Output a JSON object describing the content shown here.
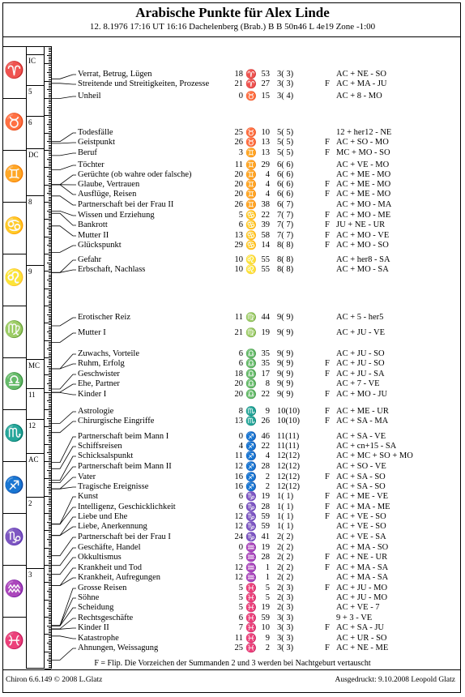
{
  "header": {
    "title": "Arabische Punkte für Alex Linde",
    "subtitle": "12. 8.1976 17:16 UT 16:16 Dachelenberg (Brab.) B B 50n46 L 4e19 Zone -1:00"
  },
  "signs": [
    {
      "glyph": "♈",
      "name": "aries",
      "color": "#d00000"
    },
    {
      "glyph": "♉",
      "name": "taurus",
      "color": "#00a000"
    },
    {
      "glyph": "♊",
      "name": "gemini",
      "color": "#e08000"
    },
    {
      "glyph": "♋",
      "name": "cancer",
      "color": "#0000d0"
    },
    {
      "glyph": "♌",
      "name": "leo",
      "color": "#d00000"
    },
    {
      "glyph": "♍",
      "name": "virgo",
      "color": "#00a000"
    },
    {
      "glyph": "♎",
      "name": "libra",
      "color": "#e08000"
    },
    {
      "glyph": "♏",
      "name": "scorpio",
      "color": "#0000d0"
    },
    {
      "glyph": "♐",
      "name": "sagittarius",
      "color": "#d00000"
    },
    {
      "glyph": "♑",
      "name": "capricorn",
      "color": "#00a000"
    },
    {
      "glyph": "♒",
      "name": "aquarius",
      "color": "#e08000"
    },
    {
      "glyph": "♓",
      "name": "pisces",
      "color": "#0000d0"
    }
  ],
  "houses": [
    "IC",
    "5",
    "6",
    "DC",
    "8",
    "9",
    "MC",
    "11",
    "12",
    "AC",
    "2",
    "3"
  ],
  "rows": [
    {
      "name": "Verrat, Betrug, Lügen",
      "deg": "18",
      "sign": 0,
      "min": "53",
      "house": "3(  3)",
      "flip": "",
      "formula": "AC + NE - SO"
    },
    {
      "name": "Streitende und Streitigkeiten, Prozesse",
      "deg": "21",
      "sign": 0,
      "min": "27",
      "house": "3(  3)",
      "flip": "F",
      "formula": "AC + MA - JU"
    },
    {
      "name": "Unheil",
      "deg": "0",
      "sign": 1,
      "min": "15",
      "house": "3(  4)",
      "flip": "",
      "formula": "AC + 8 - MO"
    },
    {
      "name": "Todesfälle",
      "deg": "25",
      "sign": 1,
      "min": "10",
      "house": "5(  5)",
      "flip": "",
      "formula": "12 + her12 - NE"
    },
    {
      "name": "Geistpunkt",
      "deg": "26",
      "sign": 1,
      "min": "13",
      "house": "5(  5)",
      "flip": "F",
      "formula": "AC + SO - MO"
    },
    {
      "name": "Beruf",
      "deg": "3",
      "sign": 2,
      "min": "13",
      "house": "5(  5)",
      "flip": "F",
      "formula": "MC + MO - SO"
    },
    {
      "name": "Töchter",
      "deg": "11",
      "sign": 2,
      "min": "29",
      "house": "6(  6)",
      "flip": "",
      "formula": "AC + VE - MO"
    },
    {
      "name": "Gerüchte (ob wahre oder falsche)",
      "deg": "20",
      "sign": 2,
      "min": "4",
      "house": "6(  6)",
      "flip": "",
      "formula": "AC + ME - MO"
    },
    {
      "name": "Glaube, Vertrauen",
      "deg": "20",
      "sign": 2,
      "min": "4",
      "house": "6(  6)",
      "flip": "F",
      "formula": "AC + ME - MO"
    },
    {
      "name": "Ausflüge, Reisen",
      "deg": "20",
      "sign": 2,
      "min": "4",
      "house": "6(  6)",
      "flip": "F",
      "formula": "AC + ME - MO"
    },
    {
      "name": "Partnerschaft bei der Frau II",
      "deg": "26",
      "sign": 2,
      "min": "38",
      "house": "6(  7)",
      "flip": "",
      "formula": "AC + MO - MA"
    },
    {
      "name": "Wissen und Erziehung",
      "deg": "5",
      "sign": 3,
      "min": "22",
      "house": "7(  7)",
      "flip": "F",
      "formula": "AC + MO - ME"
    },
    {
      "name": "Bankrott",
      "deg": "6",
      "sign": 3,
      "min": "39",
      "house": "7(  7)",
      "flip": "F",
      "formula": "JU + NE - UR"
    },
    {
      "name": "Mutter II",
      "deg": "13",
      "sign": 3,
      "min": "58",
      "house": "7(  7)",
      "flip": "F",
      "formula": "AC + MO - VE"
    },
    {
      "name": "Glückspunkt",
      "deg": "29",
      "sign": 3,
      "min": "14",
      "house": "8(  8)",
      "flip": "F",
      "formula": "AC + MO - SO"
    },
    {
      "name": "Gefahr",
      "deg": "10",
      "sign": 4,
      "min": "55",
      "house": "8(  8)",
      "flip": "",
      "formula": "AC + her8 - SA"
    },
    {
      "name": "Erbschaft, Nachlass",
      "deg": "10",
      "sign": 4,
      "min": "55",
      "house": "8(  8)",
      "flip": "",
      "formula": "AC + MO - SA"
    },
    {
      "name": "Erotischer Reiz",
      "deg": "11",
      "sign": 5,
      "min": "44",
      "house": "9(  9)",
      "flip": "",
      "formula": "AC + 5 - her5"
    },
    {
      "name": "Mutter I",
      "deg": "21",
      "sign": 5,
      "min": "19",
      "house": "9(  9)",
      "flip": "",
      "formula": "AC + JU - VE"
    },
    {
      "name": "Zuwachs, Vorteile",
      "deg": "6",
      "sign": 6,
      "min": "35",
      "house": "9(  9)",
      "flip": "",
      "formula": "AC + JU - SO"
    },
    {
      "name": "Ruhm, Erfolg",
      "deg": "6",
      "sign": 6,
      "min": "35",
      "house": "9(  9)",
      "flip": "F",
      "formula": "AC + JU - SO"
    },
    {
      "name": "Geschwister",
      "deg": "18",
      "sign": 6,
      "min": "17",
      "house": "9(  9)",
      "flip": "F",
      "formula": "AC + JU - SA"
    },
    {
      "name": "Ehe, Partner",
      "deg": "20",
      "sign": 6,
      "min": "8",
      "house": "9(  9)",
      "flip": "",
      "formula": "AC + 7 - VE"
    },
    {
      "name": "Kinder I",
      "deg": "20",
      "sign": 6,
      "min": "22",
      "house": "9(  9)",
      "flip": "F",
      "formula": "AC + MO - JU"
    },
    {
      "name": "Astrologie",
      "deg": "8",
      "sign": 7,
      "min": "9",
      "house": "10(10)",
      "flip": "F",
      "formula": "AC + ME - UR"
    },
    {
      "name": "Chirurgische Eingriffe",
      "deg": "13",
      "sign": 7,
      "min": "26",
      "house": "10(10)",
      "flip": "F",
      "formula": "AC + SA - MA"
    },
    {
      "name": "Partnerschaft beim Mann I",
      "deg": "0",
      "sign": 8,
      "min": "46",
      "house": "11(11)",
      "flip": "",
      "formula": "AC + SA - VE"
    },
    {
      "name": "Schiffsreisen",
      "deg": "4",
      "sign": 8,
      "min": "22",
      "house": "11(11)",
      "flip": "",
      "formula": "AC + cn+15 - SA"
    },
    {
      "name": "Schicksalspunkt",
      "deg": "11",
      "sign": 8,
      "min": "4",
      "house": "12(12)",
      "flip": "",
      "formula": "AC + MC + SO + MO"
    },
    {
      "name": "Partnerschaft beim Mann II",
      "deg": "12",
      "sign": 8,
      "min": "28",
      "house": "12(12)",
      "flip": "",
      "formula": "AC + SO - VE"
    },
    {
      "name": "Vater",
      "deg": "16",
      "sign": 8,
      "min": "2",
      "house": "12(12)",
      "flip": "F",
      "formula": "AC + SA - SO"
    },
    {
      "name": "Tragische Ereignisse",
      "deg": "16",
      "sign": 8,
      "min": "2",
      "house": "12(12)",
      "flip": "",
      "formula": "AC + SA - SO"
    },
    {
      "name": "Kunst",
      "deg": "6",
      "sign": 9,
      "min": "19",
      "house": "1(  1)",
      "flip": "F",
      "formula": "AC + ME - VE"
    },
    {
      "name": "Intelligenz, Geschicklichkeit",
      "deg": "6",
      "sign": 9,
      "min": "28",
      "house": "1(  1)",
      "flip": "F",
      "formula": "AC + MA - ME"
    },
    {
      "name": "Liebe und Ehe",
      "deg": "12",
      "sign": 9,
      "min": "59",
      "house": "1(  1)",
      "flip": "F",
      "formula": "AC + VE - SO"
    },
    {
      "name": "Liebe, Anerkennung",
      "deg": "12",
      "sign": 9,
      "min": "59",
      "house": "1(  1)",
      "flip": "",
      "formula": "AC + VE - SO"
    },
    {
      "name": "Partnerschaft bei der Frau I",
      "deg": "24",
      "sign": 9,
      "min": "41",
      "house": "2(  2)",
      "flip": "",
      "formula": "AC + VE - SA"
    },
    {
      "name": "Geschäfte, Handel",
      "deg": "0",
      "sign": 10,
      "min": "19",
      "house": "2(  2)",
      "flip": "",
      "formula": "AC + MA - SO"
    },
    {
      "name": "Okkultismus",
      "deg": "5",
      "sign": 10,
      "min": "28",
      "house": "2(  2)",
      "flip": "F",
      "formula": "AC + NE - UR"
    },
    {
      "name": "Krankheit und Tod",
      "deg": "12",
      "sign": 10,
      "min": "1",
      "house": "2(  2)",
      "flip": "F",
      "formula": "AC + MA - SA"
    },
    {
      "name": "Krankheit, Aufregungen",
      "deg": "12",
      "sign": 10,
      "min": "1",
      "house": "2(  2)",
      "flip": "",
      "formula": "AC + MA - SA"
    },
    {
      "name": "Grosse Reisen",
      "deg": "5",
      "sign": 11,
      "min": "5",
      "house": "2(  3)",
      "flip": "F",
      "formula": "AC + JU - MO"
    },
    {
      "name": "Söhne",
      "deg": "5",
      "sign": 11,
      "min": "5",
      "house": "2(  3)",
      "flip": "",
      "formula": "AC + JU - MO"
    },
    {
      "name": "Scheidung",
      "deg": "5",
      "sign": 11,
      "min": "19",
      "house": "2(  3)",
      "flip": "",
      "formula": "AC + VE - 7"
    },
    {
      "name": "Rechtsgeschäfte",
      "deg": "6",
      "sign": 11,
      "min": "59",
      "house": "3(  3)",
      "flip": "",
      "formula": "9 + 3 - VE"
    },
    {
      "name": "Kinder II",
      "deg": "7",
      "sign": 11,
      "min": "10",
      "house": "3(  3)",
      "flip": "F",
      "formula": "AC + SA - JU"
    },
    {
      "name": "Katastrophe",
      "deg": "11",
      "sign": 11,
      "min": "9",
      "house": "3(  3)",
      "flip": "",
      "formula": "AC + UR - SO"
    },
    {
      "name": "Ahnungen, Weissagung",
      "deg": "25",
      "sign": 11,
      "min": "2",
      "house": "3(  3)",
      "flip": "F",
      "formula": "AC + NE - ME"
    }
  ],
  "footnote": "F = Flip. Die Vorzeichen der Summanden 2 und 3 werden bei Nachtgeburt vertauscht",
  "footer": {
    "copyright": "Chiron 6.6.149 © 2008 L.Glatz",
    "printed": "Ausgedruckt:  9.10.2008 Leopold Glatz"
  }
}
